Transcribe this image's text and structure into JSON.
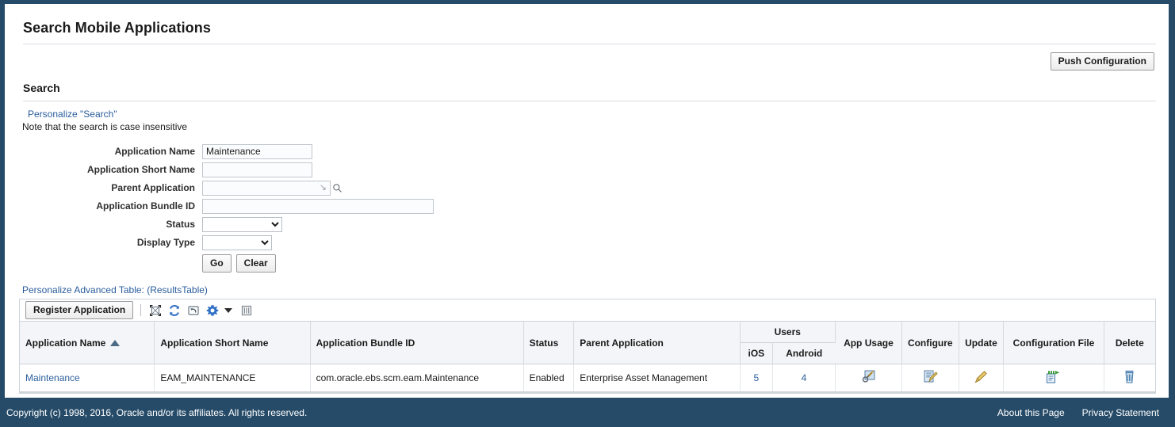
{
  "page": {
    "title": "Search Mobile Applications"
  },
  "actions": {
    "push_configuration_label": "Push Configuration"
  },
  "search": {
    "section_title": "Search",
    "personalize_link": "Personalize \"Search\"",
    "note": "Note that the search is case insensitive",
    "fields": [
      {
        "label": "Application Name",
        "value": "Maintenance",
        "placeholder": ""
      },
      {
        "label": "Application Short Name",
        "value": "",
        "placeholder": ""
      },
      {
        "label": "Parent Application",
        "value": "",
        "placeholder": ""
      },
      {
        "label": "Application Bundle ID",
        "value": "",
        "placeholder": ""
      },
      {
        "label": "Status",
        "value": "",
        "options": [
          ""
        ]
      },
      {
        "label": "Display Type",
        "value": "",
        "options": [
          ""
        ]
      }
    ],
    "go_label": "Go",
    "clear_label": "Clear"
  },
  "results": {
    "personalize_link": "Personalize Advanced Table: (ResultsTable)",
    "toolbar": {
      "register_label": "Register Application",
      "icons": [
        "expand-collapse-icon",
        "refresh-icon",
        "undo-icon",
        "gear-icon",
        "chevron-down-icon",
        "columns-icon"
      ]
    },
    "columns": {
      "application_name": "Application Name",
      "application_short_name": "Application Short Name",
      "application_bundle_id": "Application Bundle ID",
      "status": "Status",
      "parent_application": "Parent Application",
      "users_group": "Users",
      "users_ios": "iOS",
      "users_android": "Android",
      "app_usage": "App Usage",
      "configure": "Configure",
      "update": "Update",
      "configuration_file": "Configuration File",
      "delete": "Delete"
    },
    "sort": {
      "column": "Application Name",
      "direction": "ascending"
    },
    "rows": [
      {
        "application_name": "Maintenance",
        "application_short_name": "EAM_MAINTENANCE",
        "application_bundle_id": "com.oracle.ebs.scm.eam.Maintenance",
        "status": "Enabled",
        "parent_application": "Enterprise Asset Management",
        "users_ios": "5",
        "users_android": "4",
        "app_usage_icon": "app-usage-icon",
        "configure_icon": "configure-icon",
        "update_icon": "pencil-icon",
        "configuration_file_icon": "configuration-file-export-icon",
        "delete_icon": "trash-icon"
      }
    ]
  },
  "footer": {
    "copyright": "Copyright (c) 1998, 2016, Oracle and/or its affiliates. All rights reserved.",
    "about_label": "About this Page",
    "privacy_label": "Privacy Statement"
  },
  "colors": {
    "chrome": "#264b68",
    "link": "#2a5d9c",
    "header_bg": "#f3f5f8"
  }
}
